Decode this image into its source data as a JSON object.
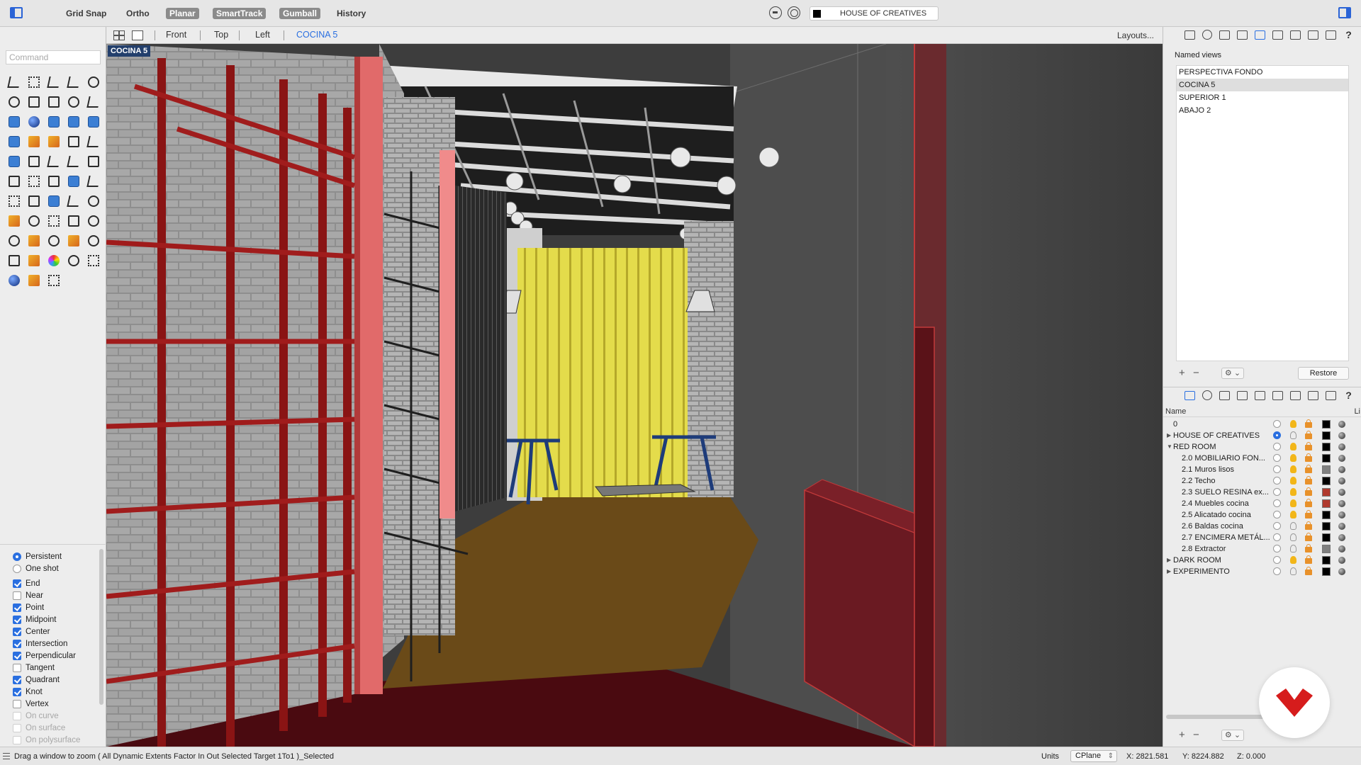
{
  "toolbar": {
    "grid_snap": "Grid Snap",
    "ortho": "Ortho",
    "planar": "Planar",
    "smarttrack": "SmartTrack",
    "gumball": "Gumball",
    "history": "History",
    "current_layer": "HOUSE OF CREATIVES",
    "current_layer_color": "#000000"
  },
  "command": {
    "placeholder": "Command"
  },
  "viewport_tabs": {
    "tabs": [
      "Front",
      "Top",
      "Left",
      "COCINA 5"
    ],
    "active": "COCINA 5",
    "layouts": "Layouts..."
  },
  "viewport": {
    "label": "COCINA 5"
  },
  "osnap": {
    "persistent": "Persistent",
    "one_shot": "One shot",
    "items": [
      {
        "label": "End",
        "checked": true
      },
      {
        "label": "Near",
        "checked": false
      },
      {
        "label": "Point",
        "checked": true
      },
      {
        "label": "Midpoint",
        "checked": true
      },
      {
        "label": "Center",
        "checked": true
      },
      {
        "label": "Intersection",
        "checked": true
      },
      {
        "label": "Perpendicular",
        "checked": true
      },
      {
        "label": "Tangent",
        "checked": false
      },
      {
        "label": "Quadrant",
        "checked": true
      },
      {
        "label": "Knot",
        "checked": true
      },
      {
        "label": "Vertex",
        "checked": false
      },
      {
        "label": "On curve",
        "checked": false
      },
      {
        "label": "On surface",
        "checked": false
      },
      {
        "label": "On polysurface",
        "checked": false
      }
    ]
  },
  "named_views": {
    "title": "Named views",
    "items": [
      "PERSPECTIVA FONDO",
      "COCINA 5",
      "SUPERIOR 1",
      "ABAJO 2"
    ],
    "selected": "COCINA 5",
    "restore": "Restore",
    "add": "+",
    "remove": "−"
  },
  "layers": {
    "name_header": "Name",
    "clip_header": "Li",
    "rows": [
      {
        "name": "0",
        "level": 0,
        "expand": "",
        "current": false,
        "on": true,
        "color": "#000000"
      },
      {
        "name": "HOUSE OF CREATIVES",
        "level": 0,
        "expand": "▶",
        "current": true,
        "on": false,
        "color": "#000000"
      },
      {
        "name": "RED ROOM",
        "level": 0,
        "expand": "▼",
        "current": false,
        "on": true,
        "color": "#000000"
      },
      {
        "name": "2.0 MOBILIARIO FON...",
        "level": 1,
        "expand": "",
        "current": false,
        "on": true,
        "color": "#000000"
      },
      {
        "name": "2.1 Muros lisos",
        "level": 1,
        "expand": "",
        "current": false,
        "on": true,
        "color": "#808080"
      },
      {
        "name": "2.2 Techo",
        "level": 1,
        "expand": "",
        "current": false,
        "on": true,
        "color": "#000000"
      },
      {
        "name": "2.3 SUELO RESINA ex...",
        "level": 1,
        "expand": "",
        "current": false,
        "on": true,
        "color": "#b03a2e"
      },
      {
        "name": "2.4 Muebles cocina",
        "level": 1,
        "expand": "",
        "current": false,
        "on": true,
        "color": "#b03a2e"
      },
      {
        "name": "2.5 Alicatado cocina",
        "level": 1,
        "expand": "",
        "current": false,
        "on": true,
        "color": "#000000"
      },
      {
        "name": "2.6 Baldas cocina",
        "level": 1,
        "expand": "",
        "current": false,
        "on": false,
        "color": "#000000"
      },
      {
        "name": "2.7 ENCIMERA METÁL...",
        "level": 1,
        "expand": "",
        "current": false,
        "on": false,
        "color": "#000000"
      },
      {
        "name": "2.8 Extractor",
        "level": 1,
        "expand": "",
        "current": false,
        "on": false,
        "color": "#808080"
      },
      {
        "name": "DARK ROOM",
        "level": 0,
        "expand": "▶",
        "current": false,
        "on": true,
        "color": "#000000"
      },
      {
        "name": "EXPERIMENTO",
        "level": 0,
        "expand": "▶",
        "current": false,
        "on": false,
        "color": "#000000"
      }
    ]
  },
  "status": {
    "message": "Drag a window to zoom ( All Dynamic Extents Factor In Out Selected Target 1To1 )_Selected",
    "units": "Units",
    "cplane": "CPlane",
    "x": "X: 2821.581",
    "y": "Y: 8224.882",
    "z": "Z: 0.000"
  },
  "colors": {
    "accent": "#2a6fe0",
    "red_frame": "#9b1c1c",
    "yellow_curtain": "#e6d63a",
    "floor_red": "#4a0a10",
    "brand": "#d61c1c"
  }
}
